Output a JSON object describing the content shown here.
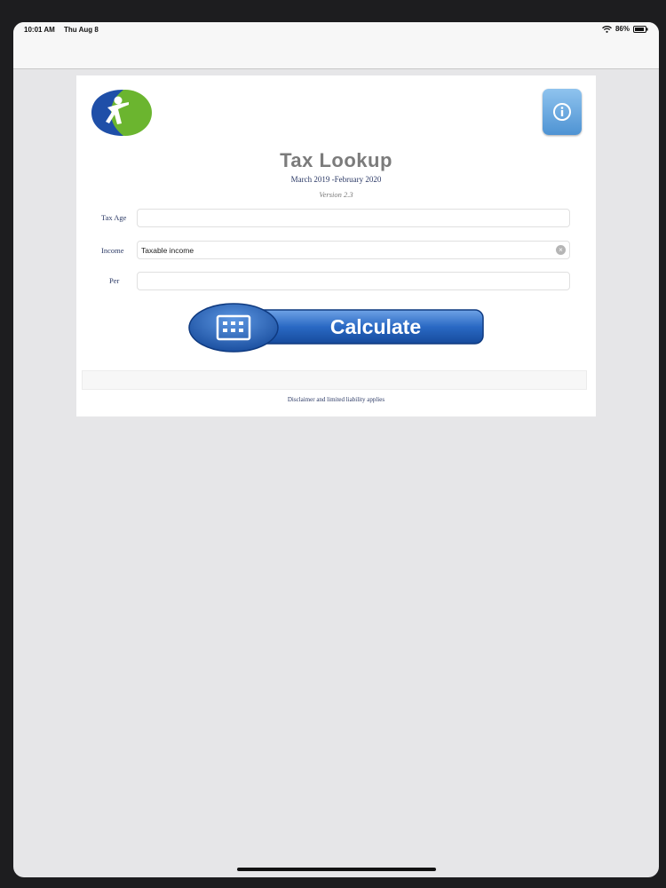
{
  "status_bar": {
    "time": "10:01 AM",
    "date": "Thu Aug 8",
    "battery": "86%"
  },
  "app": {
    "title": "Tax Lookup",
    "period": "March 2019 -February 2020",
    "version": "Version 2.3"
  },
  "form": {
    "tax_age_label": "Tax Age",
    "tax_age_value": "",
    "income_label": "Income",
    "income_value": "Taxable income",
    "per_label": "Per",
    "per_value": ""
  },
  "calculate_button": {
    "label": "Calculate"
  },
  "footer": {
    "disclaimer": "Disclaimer and limited liability applies"
  },
  "colors": {
    "accent_blue": "#1f5fb5",
    "logo_green": "#6bb52f",
    "label_navy": "#2c3a66"
  },
  "icons": [
    "wifi-icon",
    "battery-icon",
    "info-icon",
    "calculator-icon",
    "clear-icon"
  ]
}
